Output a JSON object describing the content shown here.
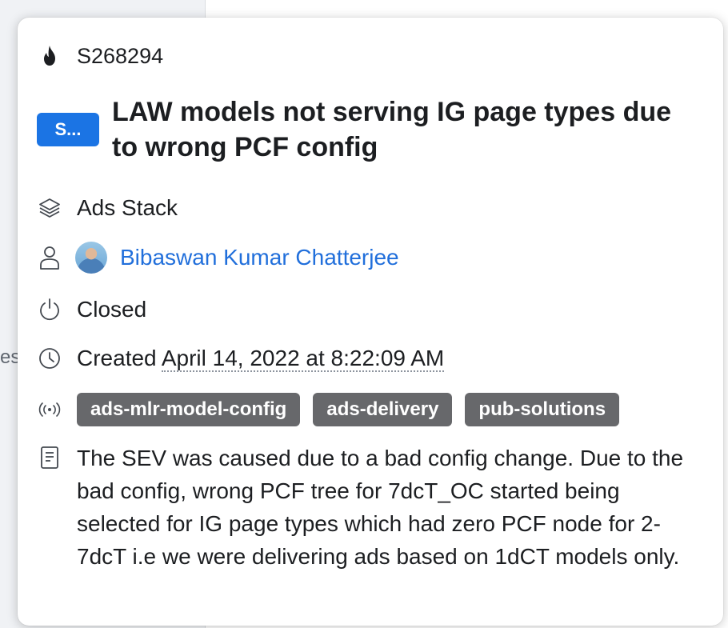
{
  "background": {
    "fragments": [
      "es"
    ]
  },
  "card": {
    "sev_id": "S268294",
    "status_badge": "S...",
    "title": "LAW models not serving IG page types due to wrong PCF config",
    "component": "Ads Stack",
    "owner": "Bibaswan Kumar Chatterjee",
    "state": "Closed",
    "created_label": "Created",
    "created_date": "April 14, 2022 at 8:22:09 AM",
    "tags": [
      "ads-mlr-model-config",
      "ads-delivery",
      "pub-solutions"
    ],
    "description": "The SEV was caused due to a bad config change. Due to the bad config, wrong PCF tree for 7dcT_OC started being selected for IG page types which had zero PCF node for 2-7dcT i.e we were delivering ads based on 1dCT models only.",
    "icons": {
      "sev": "fire-icon",
      "component": "layers-icon",
      "owner": "person-icon",
      "state": "power-icon",
      "created": "clock-icon",
      "tags": "broadcast-icon",
      "description": "document-icon"
    },
    "colors": {
      "badge": "#1b74e4",
      "link": "#216fdb",
      "tag": "#67686b"
    }
  }
}
